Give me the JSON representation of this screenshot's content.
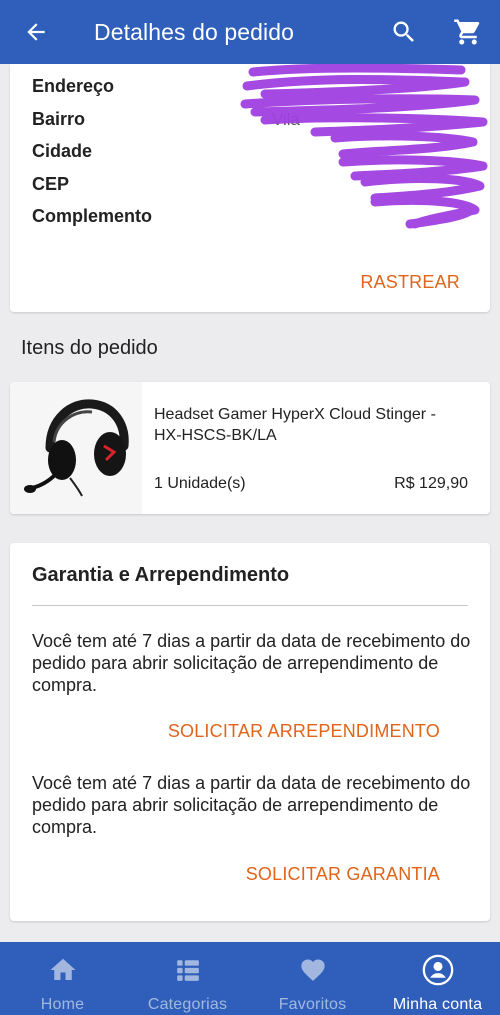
{
  "colors": {
    "primary": "#2f5fba",
    "accent": "#e0641b"
  },
  "header": {
    "title": "Detalhes do pedido",
    "back_icon": "arrow-left-icon",
    "search_icon": "search-icon",
    "cart_icon": "cart-icon"
  },
  "address": {
    "rows": [
      {
        "label": "Endereço",
        "value": ""
      },
      {
        "label": "Bairro",
        "value": "Vila"
      },
      {
        "label": "Cidade",
        "value": ""
      },
      {
        "label": "CEP",
        "value": ""
      },
      {
        "label": "Complemento",
        "value": ""
      }
    ],
    "track_label": "RASTREAR"
  },
  "items_section": {
    "title": "Itens do pedido",
    "items": [
      {
        "name": "Headset Gamer HyperX Cloud Stinger - HX-HSCS-BK/LA",
        "quantity": "1 Unidade(s)",
        "price": "R$ 129,90"
      }
    ]
  },
  "warranty": {
    "title": "Garantia e Arrependimento",
    "text_regret": "Você tem até 7 dias a partir da data de recebimento do pedido para abrir solicitação de arrependimento de compra.",
    "regret_button": "SOLICITAR ARREPENDIMENTO",
    "text_warranty": "Você tem até 7 dias a partir da data de recebimento do pedido para abrir solicitação de arrependimento de compra.",
    "warranty_button": "SOLICITAR GARANTIA"
  },
  "bottom_nav": {
    "items": [
      {
        "label": "Home",
        "icon": "home-icon",
        "active": false
      },
      {
        "label": "Categorias",
        "icon": "categories-icon",
        "active": false
      },
      {
        "label": "Favoritos",
        "icon": "heart-icon",
        "active": false
      },
      {
        "label": "Minha conta",
        "icon": "account-icon",
        "active": true
      }
    ]
  }
}
